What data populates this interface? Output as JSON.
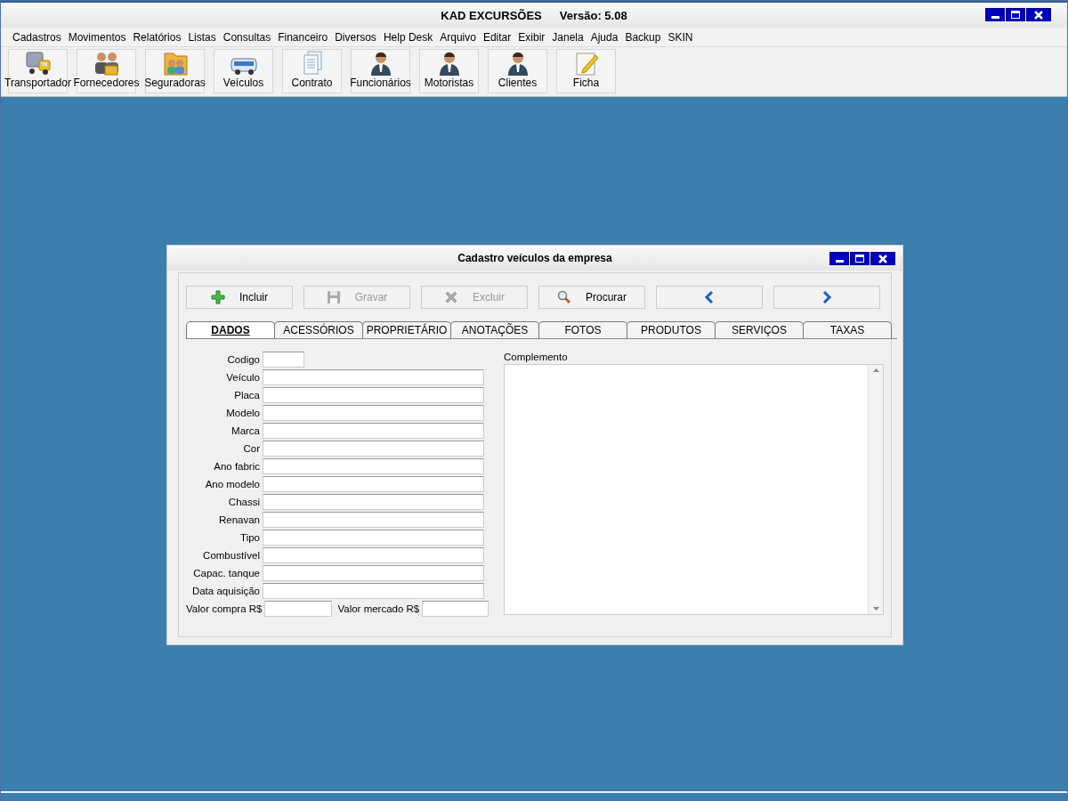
{
  "window": {
    "title": "KAD EXCURSÕES",
    "version": "Versão: 5.08"
  },
  "menu": [
    "Cadastros",
    "Movimentos",
    "Relatórios",
    "Listas",
    "Consultas",
    "Financeiro",
    "Diversos",
    "Help Desk",
    "Arquivo",
    "Editar",
    "Exibir",
    "Janela",
    "Ajuda",
    "Backup",
    "SKIN"
  ],
  "toolbar": [
    {
      "label": "Transportador",
      "kind": "truck"
    },
    {
      "label": "Fornecedores",
      "kind": "people"
    },
    {
      "label": "Seguradoras",
      "kind": "folder"
    },
    {
      "label": "Veículos",
      "kind": "bus"
    },
    {
      "label": "Contrato",
      "kind": "document"
    },
    {
      "label": "Funcionários",
      "kind": "person"
    },
    {
      "label": "Motoristas",
      "kind": "person"
    },
    {
      "label": "Clientes",
      "kind": "person"
    },
    {
      "label": "Ficha",
      "kind": "pencil"
    }
  ],
  "dialog": {
    "title": "Cadastro veículos da empresa",
    "actions": [
      {
        "label": "Incluir",
        "kind": "plus",
        "disabled": false
      },
      {
        "label": "Gravar",
        "kind": "save",
        "disabled": true
      },
      {
        "label": "Excluir",
        "kind": "delete",
        "disabled": true
      },
      {
        "label": "Procurar",
        "kind": "search",
        "disabled": false
      },
      {
        "kind": "previous",
        "disabled": false
      },
      {
        "kind": "next",
        "disabled": false
      }
    ],
    "tabs": [
      {
        "label": "DADOS",
        "selected": true
      },
      {
        "label": "ACESSÓRIOS",
        "selected": false
      },
      {
        "label": "PROPRIETÁRIO",
        "selected": false
      },
      {
        "label": "ANOTAÇÕES",
        "selected": false
      },
      {
        "label": "FOTOS",
        "selected": false
      },
      {
        "label": "PRODUTOS",
        "selected": false
      },
      {
        "label": "SERVIÇOS",
        "selected": false
      },
      {
        "label": "TAXAS",
        "selected": false
      }
    ],
    "fields": [
      {
        "label": "Codigo",
        "kind": "short"
      },
      {
        "label": "Veículo",
        "kind": "long"
      },
      {
        "label": "Placa",
        "kind": "long"
      },
      {
        "label": "Modelo",
        "kind": "long"
      },
      {
        "label": "Marca",
        "kind": "long"
      },
      {
        "label": "Cor",
        "kind": "long"
      },
      {
        "label": "Ano fabric",
        "kind": "long"
      },
      {
        "label": "Ano modelo",
        "kind": "long"
      },
      {
        "label": "Chassi",
        "kind": "long"
      },
      {
        "label": "Renavan",
        "kind": "long"
      },
      {
        "label": "Tipo",
        "kind": "long"
      },
      {
        "label": "Combustível",
        "kind": "long"
      },
      {
        "label": "Capac. tanque",
        "kind": "long"
      },
      {
        "label": "Data aquisição",
        "kind": "long"
      }
    ],
    "price_fields": [
      {
        "label": "Valor compra R$"
      },
      {
        "label": "Valor mercado R$"
      }
    ],
    "notes": {
      "label": "Complemento"
    }
  }
}
